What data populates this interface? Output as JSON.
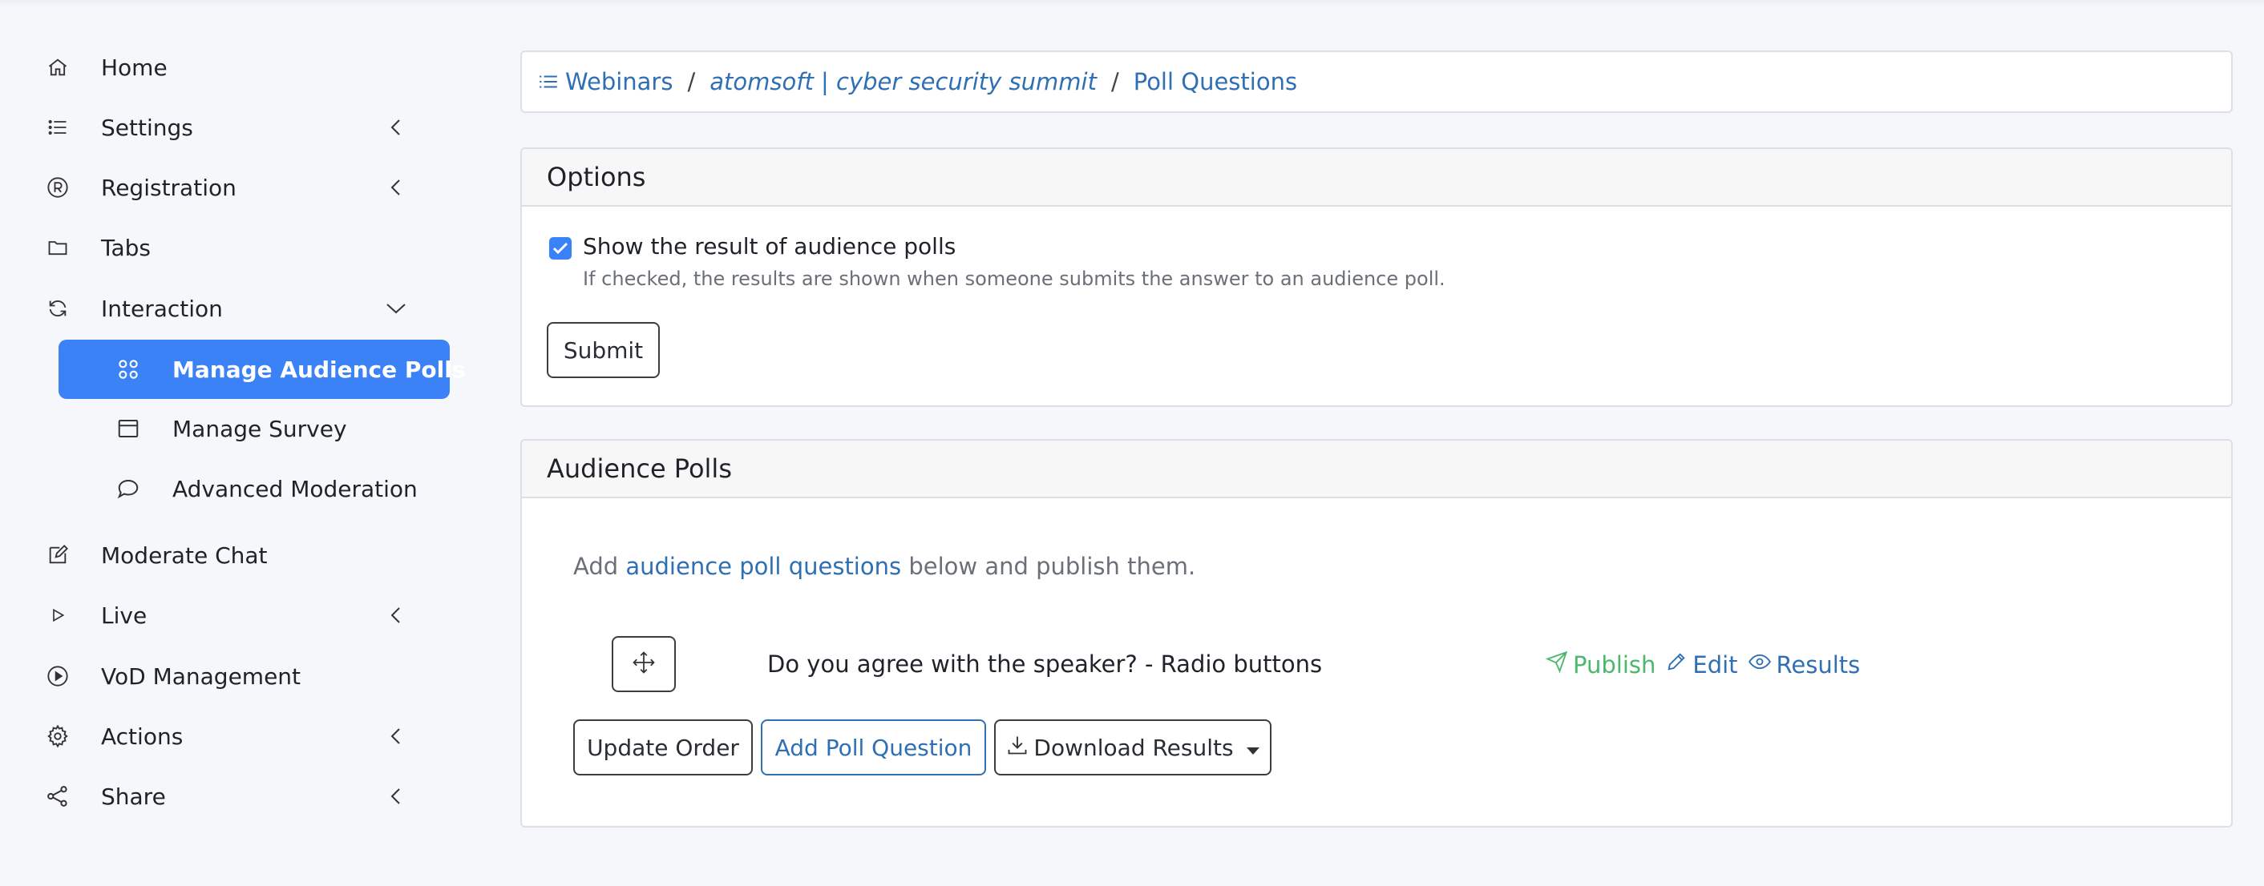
{
  "sidebar": {
    "items": [
      {
        "label": "Home",
        "icon": "home-icon"
      },
      {
        "label": "Settings",
        "icon": "list-icon"
      },
      {
        "label": "Registration",
        "icon": "registered-icon"
      },
      {
        "label": "Tabs",
        "icon": "folder-icon"
      },
      {
        "label": "Interaction",
        "icon": "refresh-icon"
      },
      {
        "label": "Moderate Chat",
        "icon": "edit-icon"
      },
      {
        "label": "Live",
        "icon": "play-outline-icon"
      },
      {
        "label": "VoD Management",
        "icon": "play-circle-icon"
      },
      {
        "label": "Actions",
        "icon": "gear-icon"
      },
      {
        "label": "Share",
        "icon": "share-icon"
      }
    ],
    "sub_items": [
      {
        "label": "Manage Audience Polls",
        "icon": "polls-icon",
        "active": true
      },
      {
        "label": "Manage Survey",
        "icon": "window-icon"
      },
      {
        "label": "Advanced Moderation",
        "icon": "chat-bubble-icon"
      }
    ]
  },
  "breadcrumb": {
    "webinars": "Webinars",
    "event": "atomsoft | cyber security summit",
    "current": "Poll Questions",
    "separator": "/"
  },
  "options": {
    "title": "Options",
    "checkbox_label": "Show the result of audience polls",
    "checkbox_checked": true,
    "help_text": "If checked, the results are shown when someone submits the answer to an audience poll.",
    "submit_label": "Submit"
  },
  "polls": {
    "title": "Audience Polls",
    "intro_prefix": "Add ",
    "intro_link": "audience poll questions",
    "intro_suffix": " below and publish them.",
    "questions": [
      {
        "title": "Do you agree with the speaker? - Radio buttons"
      }
    ],
    "actions": {
      "publish": "Publish",
      "edit": "Edit",
      "results": "Results"
    },
    "buttons": {
      "update_order": "Update Order",
      "add_question": "Add Poll Question",
      "download_results": "Download Results"
    }
  },
  "colors": {
    "accent": "#3b82f6",
    "link": "#2f6fb3",
    "publish": "#4cb86b"
  }
}
